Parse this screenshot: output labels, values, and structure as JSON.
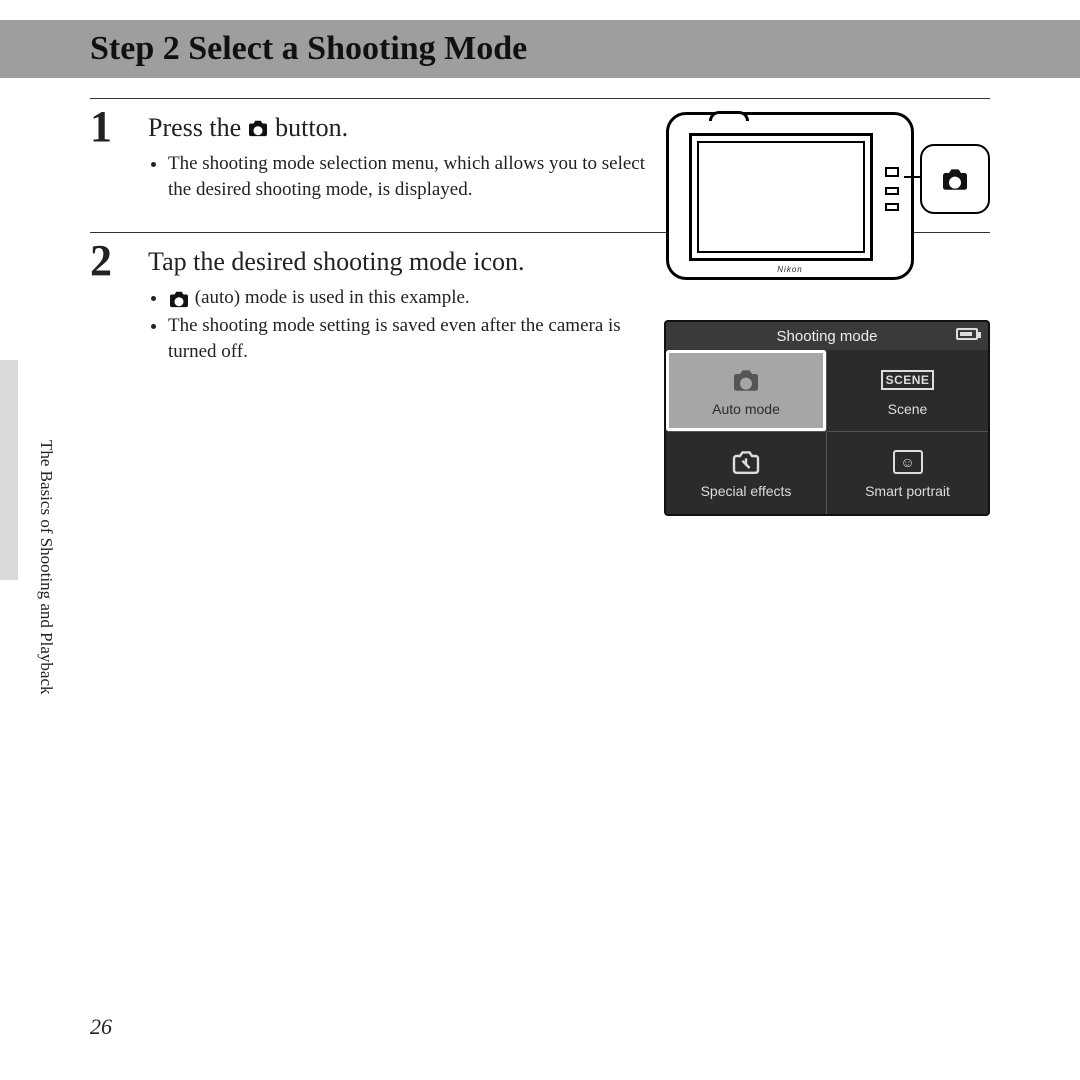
{
  "header": {
    "title": "Step 2 Select a Shooting Mode"
  },
  "steps": {
    "s1": {
      "num": "1",
      "title_before": "Press the",
      "title_after": "button.",
      "bullets": [
        "The shooting mode selection menu, which allows you to select the desired shooting mode, is displayed."
      ]
    },
    "s2": {
      "num": "2",
      "title": "Tap the desired shooting mode icon.",
      "bullet_auto_after": "(auto) mode is used in this example.",
      "bullet_saved": "The shooting mode setting is saved even after the camera is turned off."
    }
  },
  "camera": {
    "brand": "Nikon"
  },
  "mode_menu": {
    "title": "Shooting mode",
    "auto": "Auto mode",
    "scene": "Scene",
    "scene_icon": "SCENE",
    "special": "Special effects",
    "smart": "Smart portrait"
  },
  "sidebar": {
    "chapter": "The Basics of Shooting and Playback"
  },
  "page_number": "26"
}
